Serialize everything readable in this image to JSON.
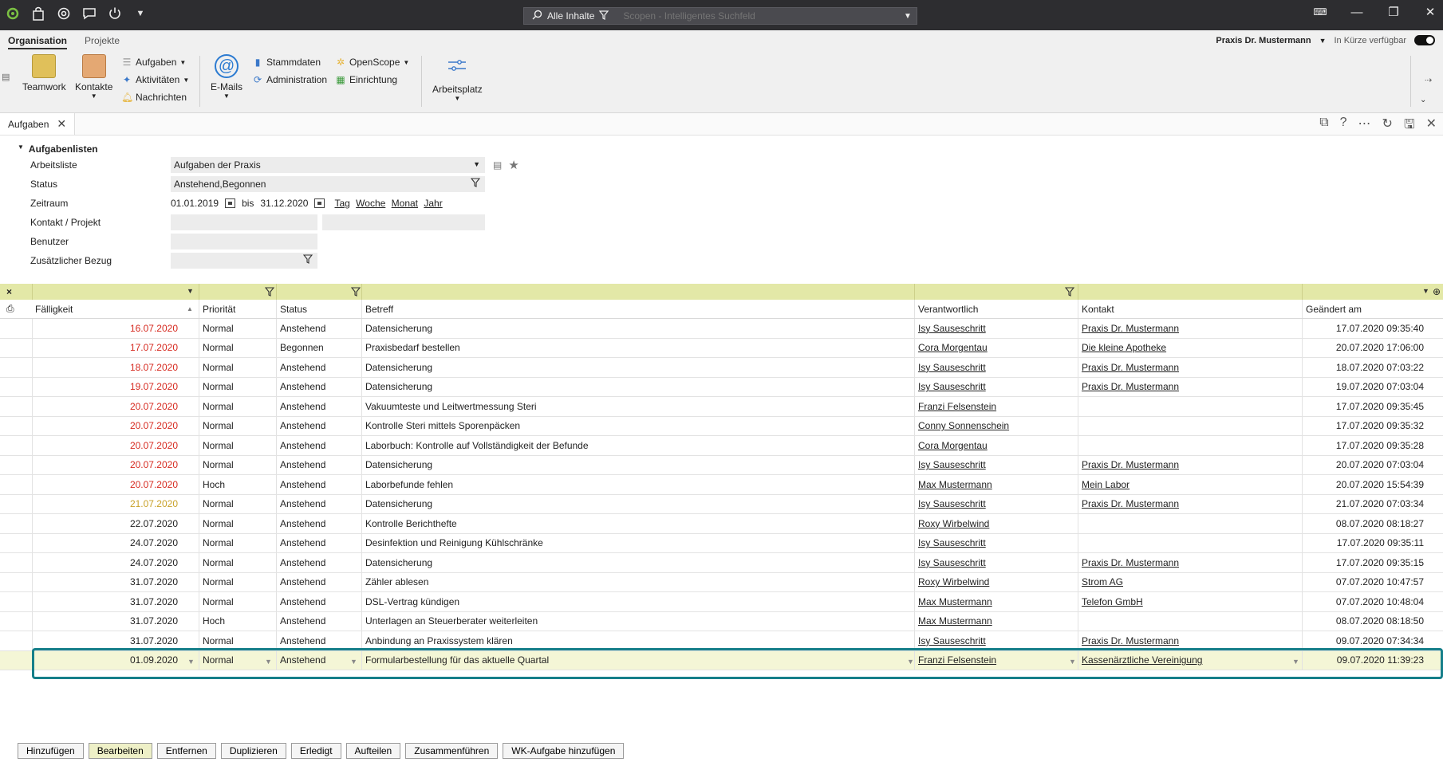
{
  "search": {
    "scope_label": "Alle Inhalte",
    "placeholder": "Scopen - Intelligentes Suchfeld"
  },
  "ribbon": {
    "tabs": [
      "Organisation",
      "Projekte"
    ],
    "practice": "Praxis Dr. Mustermann",
    "availability": "In Kürze verfügbar",
    "buttons": {
      "teamwork": "Teamwork",
      "contacts": "Kontakte",
      "tasks": "Aufgaben",
      "activities": "Aktivitäten",
      "messages": "Nachrichten",
      "emails": "E-Mails",
      "master_data": "Stammdaten",
      "administration": "Administration",
      "openscope": "OpenScope",
      "setup": "Einrichtung",
      "workplace": "Arbeitsplatz"
    }
  },
  "doc_tab": {
    "label": "Aufgaben"
  },
  "filters": {
    "section_title": "Aufgabenlisten",
    "worklist_label": "Arbeitsliste",
    "worklist_value": "Aufgaben der Praxis",
    "status_label": "Status",
    "status_value": "Anstehend,Begonnen",
    "period_label": "Zeitraum",
    "period_from": "01.01.2019",
    "period_bis": "bis",
    "period_to": "31.12.2020",
    "period_links": [
      "Tag",
      "Woche",
      "Monat",
      "Jahr"
    ],
    "contact_label": "Kontakt / Projekt",
    "user_label": "Benutzer",
    "extra_label": "Zusätzlicher Bezug"
  },
  "grid": {
    "headers": [
      "Fälligkeit",
      "Priorität",
      "Status",
      "Betreff",
      "Verantwortlich",
      "Kontakt",
      "Geändert am"
    ],
    "rows": [
      {
        "due": "16.07.2020",
        "due_state": "red",
        "priority": "Normal",
        "status": "Anstehend",
        "subject": "Datensicherung",
        "owner": "Isy Sauseschritt",
        "contact": "Praxis Dr. Mustermann",
        "changed": "17.07.2020 09:35:40"
      },
      {
        "due": "17.07.2020",
        "due_state": "red",
        "priority": "Normal",
        "status": "Begonnen",
        "subject": "Praxisbedarf bestellen",
        "owner": "Cora Morgentau",
        "contact": "Die kleine Apotheke",
        "changed": "20.07.2020 17:06:00"
      },
      {
        "due": "18.07.2020",
        "due_state": "red",
        "priority": "Normal",
        "status": "Anstehend",
        "subject": "Datensicherung",
        "owner": "Isy Sauseschritt",
        "contact": "Praxis Dr. Mustermann",
        "changed": "18.07.2020 07:03:22"
      },
      {
        "due": "19.07.2020",
        "due_state": "red",
        "priority": "Normal",
        "status": "Anstehend",
        "subject": "Datensicherung",
        "owner": "Isy Sauseschritt",
        "contact": "Praxis Dr. Mustermann",
        "changed": "19.07.2020 07:03:04"
      },
      {
        "due": "20.07.2020",
        "due_state": "red",
        "priority": "Normal",
        "status": "Anstehend",
        "subject": "Vakuumteste und Leitwertmessung Steri",
        "owner": "Franzi Felsenstein",
        "contact": "",
        "changed": "17.07.2020 09:35:45"
      },
      {
        "due": "20.07.2020",
        "due_state": "red",
        "priority": "Normal",
        "status": "Anstehend",
        "subject": "Kontrolle Steri mittels Sporenpäcken",
        "owner": "Conny Sonnenschein",
        "contact": "",
        "changed": "17.07.2020 09:35:32"
      },
      {
        "due": "20.07.2020",
        "due_state": "red",
        "priority": "Normal",
        "status": "Anstehend",
        "subject": "Laborbuch: Kontrolle auf Vollständigkeit der Befunde",
        "owner": "Cora Morgentau",
        "contact": "",
        "changed": "17.07.2020 09:35:28"
      },
      {
        "due": "20.07.2020",
        "due_state": "red",
        "priority": "Normal",
        "status": "Anstehend",
        "subject": "Datensicherung",
        "owner": "Isy Sauseschritt",
        "contact": "Praxis Dr. Mustermann",
        "changed": "20.07.2020 07:03:04"
      },
      {
        "due": "20.07.2020",
        "due_state": "red",
        "priority": "Hoch",
        "status": "Anstehend",
        "subject": "Laborbefunde fehlen",
        "owner": "Max Mustermann",
        "contact": "Mein Labor",
        "changed": "20.07.2020 15:54:39"
      },
      {
        "due": "21.07.2020",
        "due_state": "orange",
        "priority": "Normal",
        "status": "Anstehend",
        "subject": "Datensicherung",
        "owner": "Isy Sauseschritt",
        "contact": "Praxis Dr. Mustermann",
        "changed": "21.07.2020 07:03:34"
      },
      {
        "due": "22.07.2020",
        "due_state": "normal",
        "priority": "Normal",
        "status": "Anstehend",
        "subject": "Kontrolle Berichthefte",
        "owner": "Roxy Wirbelwind",
        "contact": "",
        "changed": "08.07.2020 08:18:27"
      },
      {
        "due": "24.07.2020",
        "due_state": "normal",
        "priority": "Normal",
        "status": "Anstehend",
        "subject": "Desinfektion und Reinigung Kühlschränke",
        "owner": "Isy Sauseschritt",
        "contact": "",
        "changed": "17.07.2020 09:35:11"
      },
      {
        "due": "24.07.2020",
        "due_state": "normal",
        "priority": "Normal",
        "status": "Anstehend",
        "subject": "Datensicherung",
        "owner": "Isy Sauseschritt",
        "contact": "Praxis Dr. Mustermann",
        "changed": "17.07.2020 09:35:15"
      },
      {
        "due": "31.07.2020",
        "due_state": "normal",
        "priority": "Normal",
        "status": "Anstehend",
        "subject": "Zähler ablesen",
        "owner": "Roxy Wirbelwind",
        "contact": "Strom AG",
        "changed": "07.07.2020 10:47:57"
      },
      {
        "due": "31.07.2020",
        "due_state": "normal",
        "priority": "Normal",
        "status": "Anstehend",
        "subject": "DSL-Vertrag kündigen",
        "owner": "Max Mustermann",
        "contact": "Telefon GmbH",
        "changed": "07.07.2020 10:48:04"
      },
      {
        "due": "31.07.2020",
        "due_state": "normal",
        "priority": "Hoch",
        "status": "Anstehend",
        "subject": "Unterlagen an Steuerberater weiterleiten",
        "owner": "Max Mustermann",
        "contact": "",
        "changed": "08.07.2020 08:18:50"
      },
      {
        "due": "31.07.2020",
        "due_state": "normal",
        "priority": "Normal",
        "status": "Anstehend",
        "subject": "Anbindung an Praxissystem klären",
        "owner": "Isy Sauseschritt",
        "contact": "Praxis Dr. Mustermann",
        "changed": "09.07.2020 07:34:34"
      },
      {
        "due": "01.09.2020",
        "due_state": "normal",
        "priority": "Normal",
        "status": "Anstehend",
        "subject": "Formularbestellung für das aktuelle Quartal",
        "owner": "Franzi Felsenstein",
        "contact": "Kassenärztliche Vereinigung",
        "changed": "09.07.2020 11:39:23",
        "selected": true
      }
    ]
  },
  "actions": [
    "Hinzufügen",
    "Bearbeiten",
    "Entfernen",
    "Duplizieren",
    "Erledigt",
    "Aufteilen",
    "Zusammenführen",
    "WK-Aufgabe hinzufügen"
  ],
  "colors": {
    "titlebar": "#2d2d30",
    "filter_row": "#e3e8a7",
    "overdue": "#d62a20",
    "due_today": "#c9a22a",
    "selection_border": "#167f8a"
  }
}
